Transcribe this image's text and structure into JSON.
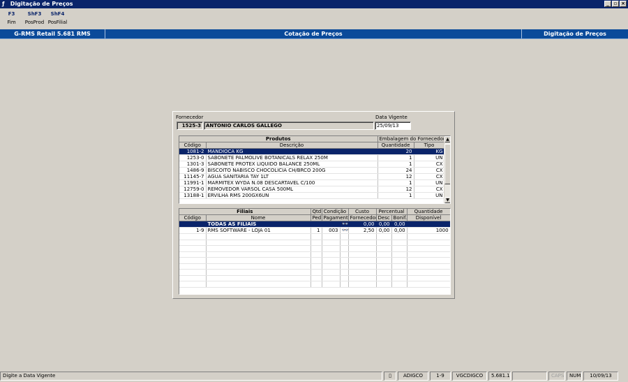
{
  "window": {
    "title": "Digitação de Preços",
    "minimize_label": "_",
    "restore_label": "▫",
    "close_label": "×"
  },
  "function_keys": [
    {
      "key": "F3",
      "label": "Fim"
    },
    {
      "key": "ShF3",
      "label": "PosProd"
    },
    {
      "key": "ShF4",
      "label": "PosFilial"
    }
  ],
  "header_bar": {
    "app_version": "G-RMS Retail 5.681 RMS",
    "module": "Cotação de Preços",
    "screen": "Digitação de Preços"
  },
  "form": {
    "supplier_label": "Fornecedor",
    "supplier_code": "1525-3",
    "supplier_name": "ANTONIO CARLOS GALLEGO",
    "date_label": "Data Vigente",
    "date_value": "25/09/13"
  },
  "products_grid": {
    "group_products": "Produtos",
    "group_packaging": "Embalagem do Fornecedor",
    "col_code": "Código",
    "col_description": "Descrição",
    "col_quantity": "Quantidade",
    "col_type": "Tipo",
    "rows": [
      {
        "code": "1081-2",
        "description": "MANDIOCA KG",
        "quantity": "20",
        "type": "KG"
      },
      {
        "code": "1253-0",
        "description": "SABONETE PALMOLIVE BOTANICALS RELAX 250M",
        "quantity": "1",
        "type": "UN"
      },
      {
        "code": "1301-3",
        "description": "SABONETE PROTEX LIQUIDO BALANCE 250ML",
        "quantity": "1",
        "type": "CX"
      },
      {
        "code": "1486-9",
        "description": "BISCOITO NABISCO CHOCOLICIA CH/BRCO 200G",
        "quantity": "24",
        "type": "CX"
      },
      {
        "code": "11145-7",
        "description": "AGUA SANITARIA TAY 1LT",
        "quantity": "12",
        "type": "CX"
      },
      {
        "code": "11991-1",
        "description": "MARMITEX WYDA N.08 DESCARTAVEL C/100",
        "quantity": "1",
        "type": "UN"
      },
      {
        "code": "12759-0",
        "description": "REMOVEDOR VARSOL CASA 500ML",
        "quantity": "12",
        "type": "CX"
      },
      {
        "code": "13188-1",
        "description": "ERVILHA RMS 200GX6UN",
        "quantity": "1",
        "type": "UN"
      }
    ]
  },
  "branches_grid": {
    "group_branches": "Filiais",
    "col_code": "Código",
    "col_name": "Nome",
    "col_qty_1": "Qtd.",
    "col_qty_2": "Ped",
    "col_cond_1": "Condição",
    "col_cond_2": "Pagamento",
    "col_cost_1": "Custo",
    "col_cost_2": "Fornecedor",
    "group_percent": "Percentual",
    "col_disc": "Desc",
    "col_bonus": "Bonif.",
    "col_avail_1": "Quantidade",
    "col_avail_2": "Disponível",
    "rows": [
      {
        "code": "",
        "name": "TODAS AS FILIAIS",
        "qty": "",
        "condition": "",
        "cost": "0,00",
        "disc": "0,00",
        "bonus": "0,00",
        "available": ""
      },
      {
        "code": "1-9",
        "name": "RMS SOFTWARE - LOJA 01",
        "qty": "1",
        "condition": "003",
        "cost": "2,50",
        "disc": "0,00",
        "bonus": "0,00",
        "available": "1000"
      }
    ]
  },
  "status_bar": {
    "message": "Digite a Data Vigente",
    "user": "ADIGCO",
    "store": "1-9",
    "program": "VGCDIGCO",
    "version": "5.681.1",
    "caps": "CAPS",
    "num": "NUM",
    "date": "10/09/13"
  }
}
